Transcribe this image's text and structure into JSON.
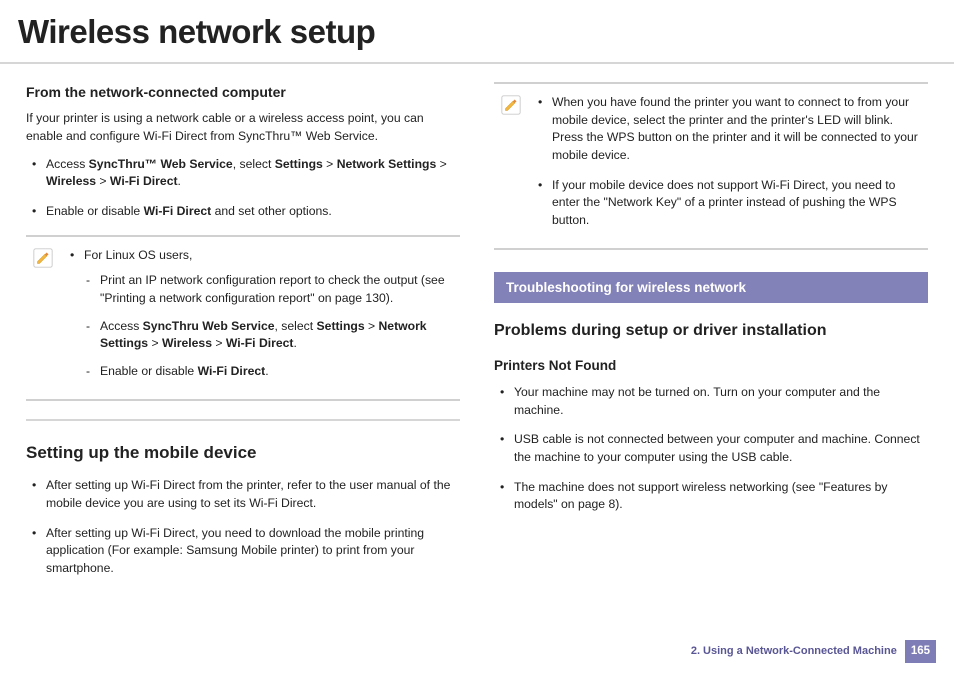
{
  "title": "Wireless network setup",
  "left": {
    "h_sub": "From the network-connected computer",
    "intro": "If your printer is using a network cable or a wireless access point, you can enable and configure Wi-Fi Direct from SyncThru™ Web Service.",
    "b1_pre": "Access ",
    "b1_strong1": "SyncThru™ Web Service",
    "b1_mid1": ", select ",
    "b1_strong2": "Settings",
    "b1_gt1": " > ",
    "b1_strong3": "Network Settings",
    "b1_gt2": " > ",
    "b1_strong4": "Wireless",
    "b1_gt3": " > ",
    "b1_strong5": "Wi-Fi Direct",
    "b1_end": ".",
    "b2_pre": "Enable or disable ",
    "b2_strong": "Wi-Fi Direct",
    "b2_end": " and set other options.",
    "note1_line1": "For Linux OS users,",
    "note1_d1": "Print an IP network configuration report to check the output (see \"Printing a network configuration report\" on page 130).",
    "note1_d2_pre": "Access ",
    "note1_d2_s1": "SyncThru Web Service",
    "note1_d2_m1": ", select ",
    "note1_d2_s2": "Settings",
    "note1_d2_g1": " > ",
    "note1_d2_s3": "Network Settings",
    "note1_d2_g2": " > ",
    "note1_d2_s4": "Wireless",
    "note1_d2_g3": " > ",
    "note1_d2_s5": "Wi-Fi Direct",
    "note1_d2_end": ".",
    "note1_d3_pre": "Enable or disable ",
    "note1_d3_s": "Wi-Fi Direct",
    "note1_d3_end": ".",
    "h_sec": "Setting up the mobile device",
    "mb1": "After setting up Wi-Fi Direct from the printer, refer to the user manual of the mobile device you are using to set its Wi-Fi Direct.",
    "mb2": "After setting up Wi-Fi Direct, you need to download the mobile printing application (For example: Samsung Mobile printer) to print from your smartphone."
  },
  "right": {
    "note2_b1": "When you have found the printer you want to connect to from your mobile device, select the printer and the printer's LED will blink. Press the WPS button on the printer and it will be connected to your mobile device.",
    "note2_b2": " If your mobile device does not support Wi-Fi Direct, you need to enter the \"Network Key\" of a printer instead of pushing the WPS button.",
    "banner": "Troubleshooting for wireless network",
    "h_mid": "Problems during setup or driver installation",
    "h_small": "Printers Not Found",
    "pb1": "Your machine may not be turned on. Turn on your computer and the machine.",
    "pb2": "USB cable is not connected between your computer and machine. Connect the machine to your computer using the USB cable.",
    "pb3": "The machine does not support wireless networking (see \"Features by models\" on page 8)."
  },
  "footer": {
    "chapter": "2.  Using a Network-Connected Machine",
    "page": "165"
  }
}
